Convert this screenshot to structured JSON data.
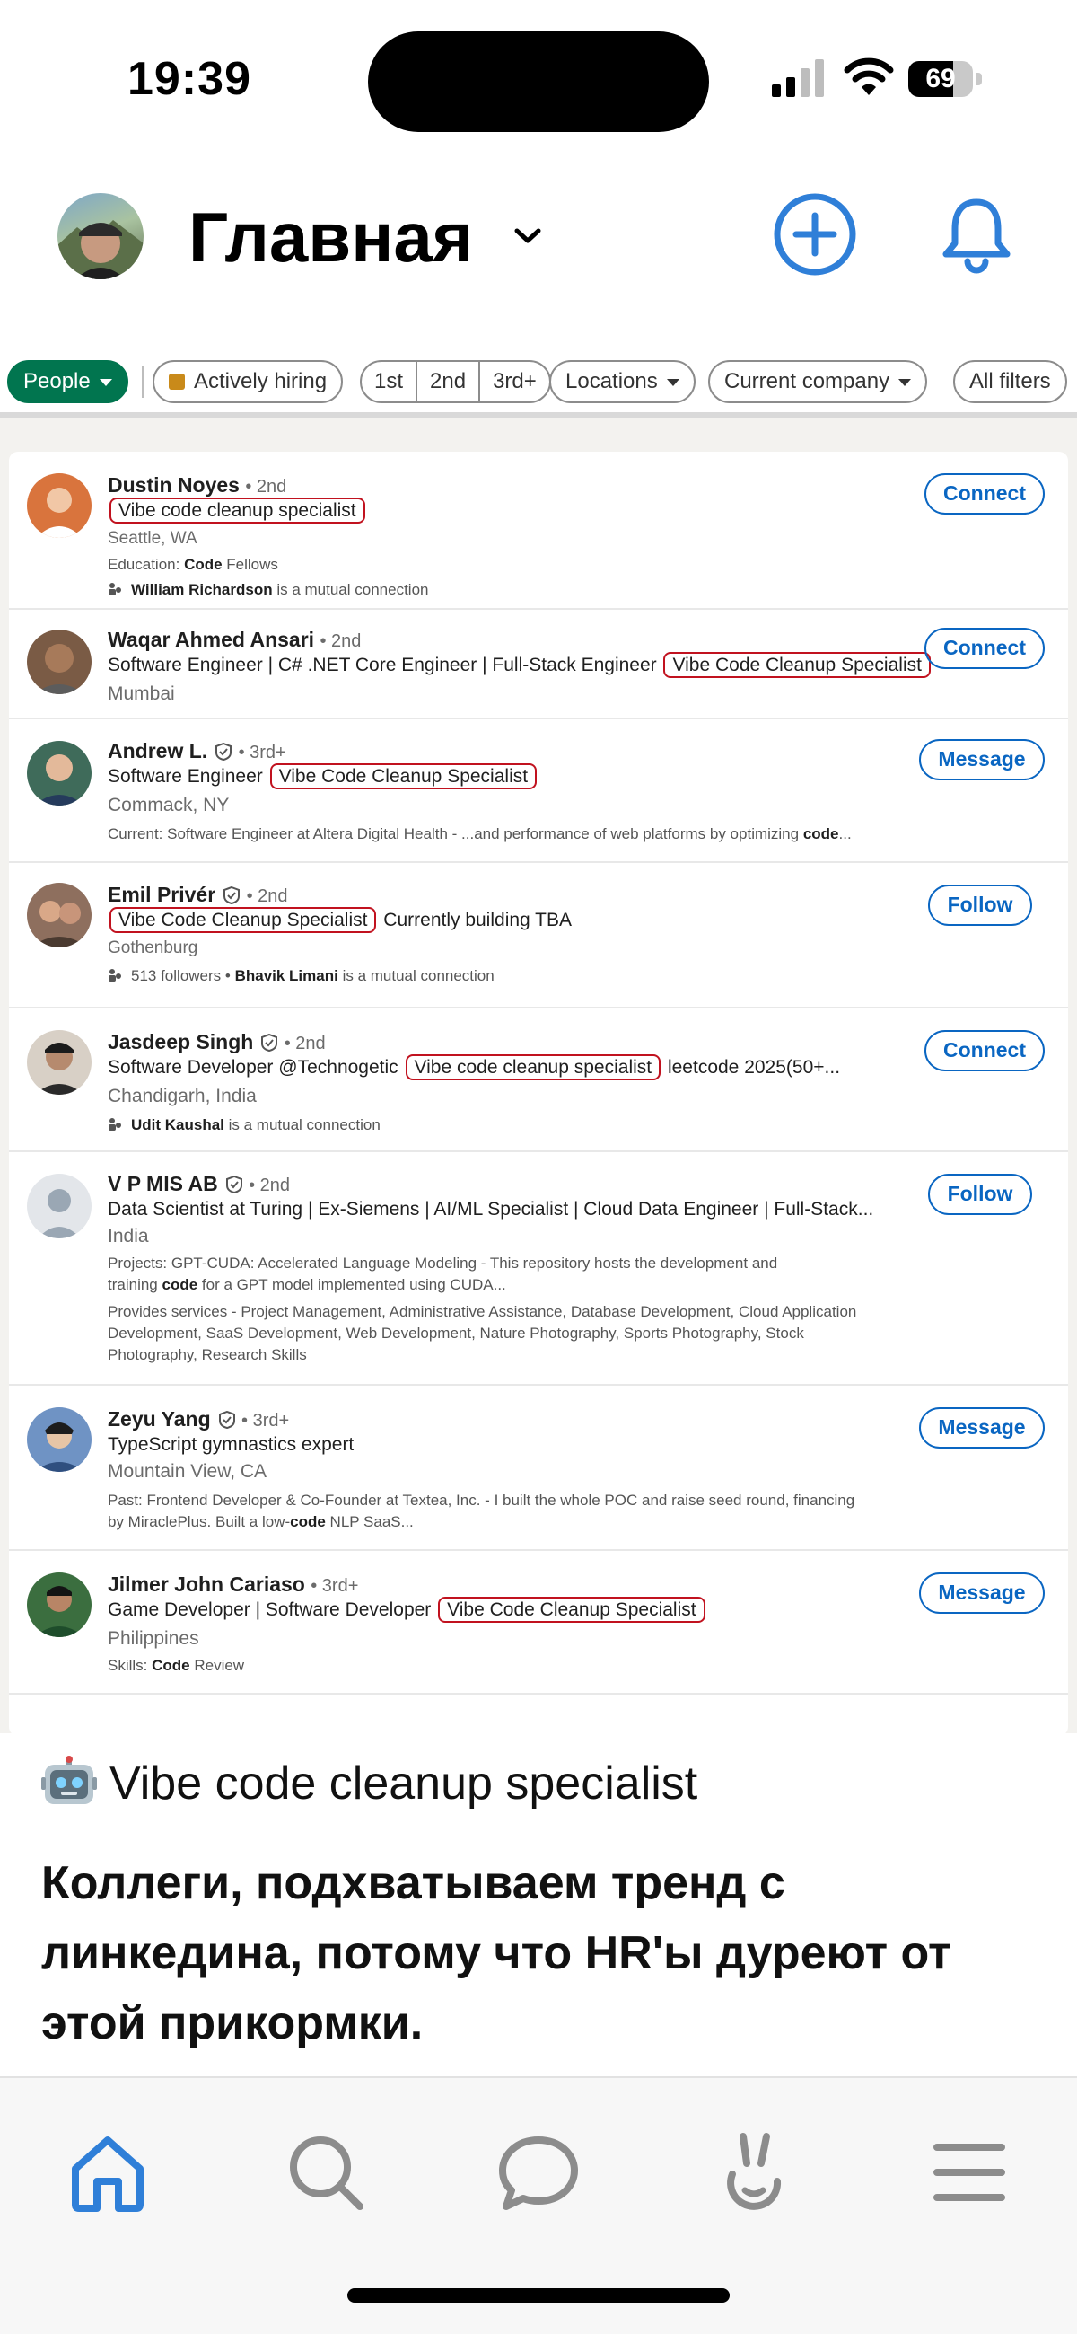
{
  "status_bar": {
    "time": "19:39",
    "battery": "69",
    "battery_level": 0.69
  },
  "header": {
    "title": "Главная"
  },
  "filters": {
    "people": "People",
    "actively_hiring": "Actively hiring",
    "degrees": [
      "1st",
      "2nd",
      "3rd+"
    ],
    "locations": "Locations",
    "current_company": "Current company",
    "all_filters": "All filters"
  },
  "results": [
    {
      "name": "Dustin Noyes",
      "degree": "• 2nd",
      "headline_pre": "",
      "headline_hl": "Vibe code cleanup specialist",
      "headline_post": "",
      "location": "Seattle, WA",
      "extra1": "Education: ",
      "extra1_b": "Code",
      "extra1_post": " Fellows",
      "mutual_name": "William Richardson",
      "mutual_rest": " is a mutual connection",
      "action": "Connect"
    },
    {
      "name": "Waqar Ahmed Ansari",
      "degree": "• 2nd",
      "headline_pre": "Software Engineer | C# .NET Core Engineer | Full-Stack Engineer ",
      "headline_hl": "Vibe Code Cleanup Specialist",
      "headline_post": "",
      "location": "Mumbai",
      "action": "Connect"
    },
    {
      "name": "Andrew L.",
      "degree": "• 3rd+",
      "headline_pre": "Software Engineer ",
      "headline_hl": "Vibe Code Cleanup Specialist",
      "headline_post": "",
      "location": "Commack, NY",
      "extra1": "Current: Software Engineer at Altera Digital Health - ...and performance of web platforms by optimizing ",
      "extra1_b": "code",
      "extra1_post": "...",
      "action": "Message"
    },
    {
      "name": "Emil Privér",
      "degree": "• 2nd",
      "headline_pre": "",
      "headline_hl": "Vibe Code Cleanup Specialist",
      "headline_post": " Currently building TBA",
      "location": "Gothenburg",
      "mutual_pre": "513 followers • ",
      "mutual_name": "Bhavik Limani",
      "mutual_rest": " is a mutual connection",
      "action": "Follow"
    },
    {
      "name": "Jasdeep Singh",
      "degree": "• 2nd",
      "headline_pre": "Software Developer @Technogetic ",
      "headline_hl": "Vibe code cleanup specialist",
      "headline_post": " leetcode 2025(50+...",
      "location": "Chandigarh, India",
      "mutual_name": "Udit Kaushal",
      "mutual_rest": " is a mutual connection",
      "action": "Connect"
    },
    {
      "name": "V P MIS AB",
      "degree": "• 2nd",
      "headline_pre": "Data Scientist at Turing | Ex-Siemens | AI/ML Specialist | Cloud Data Engineer | Full-Stack...",
      "headline_hl": "",
      "headline_post": "",
      "location": "India",
      "projects_1": "Projects: GPT-CUDA: Accelerated Language Modeling - This repository hosts the development and",
      "projects_2_pre": "training ",
      "projects_2_b": "code",
      "projects_2_post": " for a GPT model implemented using CUDA...",
      "services_1": "Provides services - Project Management, Administrative Assistance, Database Development, Cloud Application",
      "services_2": "Development, SaaS Development, Web Development, Nature Photography, Sports Photography, Stock",
      "services_3": "Photography, Research Skills",
      "action": "Follow"
    },
    {
      "name": "Zeyu Yang",
      "degree": "• 3rd+",
      "headline_pre": "TypeScript gymnastics expert",
      "headline_hl": "",
      "headline_post": "",
      "location": "Mountain View, CA",
      "past_1": "Past: Frontend Developer & Co-Founder at Textea, Inc. - I built the whole POC and raise seed round, financing",
      "past_2_pre": "by MiraclePlus. Built a low-",
      "past_2_b": "code",
      "past_2_post": " NLP SaaS...",
      "action": "Message"
    },
    {
      "name": "Jilmer John Cariaso",
      "degree": "• 3rd+",
      "headline_pre": "Game Developer | Software Developer ",
      "headline_hl": "Vibe Code Cleanup Specialist",
      "headline_post": "",
      "location": "Philippines",
      "extra1": "Skills: ",
      "extra1_b": "Code",
      "extra1_post": " Review",
      "action": "Message"
    }
  ],
  "post": {
    "title": "Vibe code cleanup specialist",
    "body": "Коллеги, подхватываем тренд с линкедина, потому что HR'ы дуреют от этой прикормки."
  },
  "tabs": [
    "home-icon",
    "search-icon",
    "chat-icon",
    "bunny-icon",
    "menu-icon"
  ],
  "colors": {
    "accent": "#2f7fd8",
    "linkedin_blue": "#0a66c2",
    "linkedin_green": "#01754f",
    "highlight": "#c1121f"
  }
}
